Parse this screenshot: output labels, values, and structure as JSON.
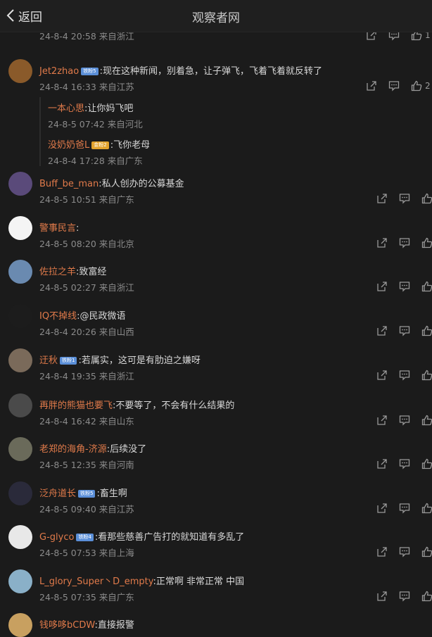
{
  "header": {
    "back_label": "返回",
    "title": "观察者网"
  },
  "comments": [
    {
      "name": "",
      "content": "",
      "meta": "24-8-4 20:58 来自浙江",
      "count": "1",
      "avatar_color": "#6a4a3a"
    },
    {
      "name": "Jet2zhao",
      "badge": "铁粉5",
      "content": ":现在这种新闻，别着急，让子弹飞，飞着飞着就反转了",
      "meta": "24-8-4 16:33 来自江苏",
      "count": "2",
      "avatar_color": "#8a5a2a"
    },
    {
      "name": "Buff_be_man",
      "content": ":私人创办的公募基金",
      "meta": "24-8-5 10:51 来自广东",
      "avatar_color": "#5a4a7a"
    },
    {
      "name": "警事民言",
      "content": ":",
      "meta": "24-8-5 08:20 来自北京",
      "avatar_color": "#f4f4f4"
    },
    {
      "name": "佐拉之羊",
      "content": ":致富经",
      "meta": "24-8-5 02:27 来自浙江",
      "avatar_color": "#6a8ab0"
    },
    {
      "name": "IQ不掉线",
      "content": ":@民政微语",
      "meta": "24-8-4 20:26 来自山西",
      "avatar_color": "#1c1c1c"
    },
    {
      "name": "迂秋",
      "badge": "铁粉1",
      "content": ":若属实，这可是有肋迫之嫌呀",
      "meta": "24-8-4 19:35 来自浙江",
      "avatar_color": "#7a6a5a"
    },
    {
      "name": "再胖的熊猫也要飞",
      "content": ":不要等了，不会有什么结果的",
      "meta": "24-8-4 16:42 来自山东",
      "avatar_color": "#4a4a4a"
    },
    {
      "name": "老郑的海角-济源",
      "content": ":后续没了",
      "meta": "24-8-5 12:35 来自河南",
      "avatar_color": "#6a6a5a"
    },
    {
      "name": "泛舟道长",
      "badge": "铁粉5",
      "content": ":畜生啊",
      "meta": "24-8-5 09:40 来自江苏",
      "avatar_color": "#2a2a3a"
    },
    {
      "name": "G-glyco",
      "badge": "铁粉4",
      "content": ":看那些慈善广告打的就知道有多乱了",
      "meta": "24-8-5 07:53 来自上海",
      "avatar_color": "#e8e8e8"
    },
    {
      "name": "L_glory_Super丶D_empty",
      "content": ":正常啊    非常正常 中国",
      "meta": "24-8-5 07:35 来自广东",
      "avatar_color": "#8ab0c8"
    },
    {
      "name": "钱哆哆bCDW",
      "content": ":直接报警",
      "meta": "",
      "avatar_color": "#c8a060"
    }
  ],
  "replies": [
    {
      "name": "一本心思",
      "content": ":让你妈飞吧",
      "meta": "24-8-5 07:42 来自河北"
    },
    {
      "name": "没奶奶爸L",
      "badge": "金粉2",
      "content": ":飞你老母",
      "meta": "24-8-4 17:28 来自广东"
    }
  ]
}
